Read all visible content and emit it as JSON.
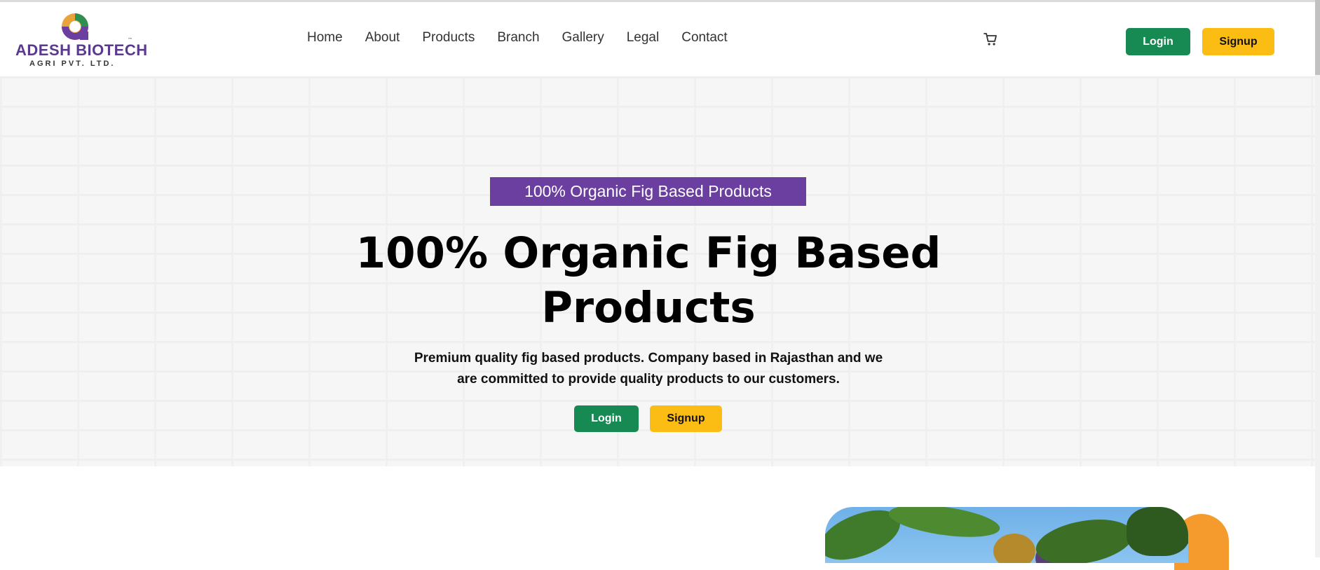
{
  "logo": {
    "title": "ADESH BIOTECH",
    "subtitle": "AGRI PVT. LTD.",
    "tm": "™"
  },
  "nav": {
    "items": [
      {
        "label": "Home"
      },
      {
        "label": "About"
      },
      {
        "label": "Products"
      },
      {
        "label": "Branch"
      },
      {
        "label": "Gallery"
      },
      {
        "label": "Legal"
      },
      {
        "label": "Contact"
      }
    ]
  },
  "header": {
    "login_label": "Login",
    "signup_label": "Signup",
    "cart_icon": "cart-icon"
  },
  "hero": {
    "badge": "100% Organic Fig Based Products",
    "title": "100% Organic Fig Based Products",
    "description": "Premium quality fig based products. Company based in Rajasthan and we are committed to provide quality products to our customers.",
    "login_label": "Login",
    "signup_label": "Signup"
  },
  "colors": {
    "brand_purple": "#6b3fa0",
    "green": "#178a54",
    "yellow": "#fbbd14",
    "orange": "#f59b2e"
  }
}
